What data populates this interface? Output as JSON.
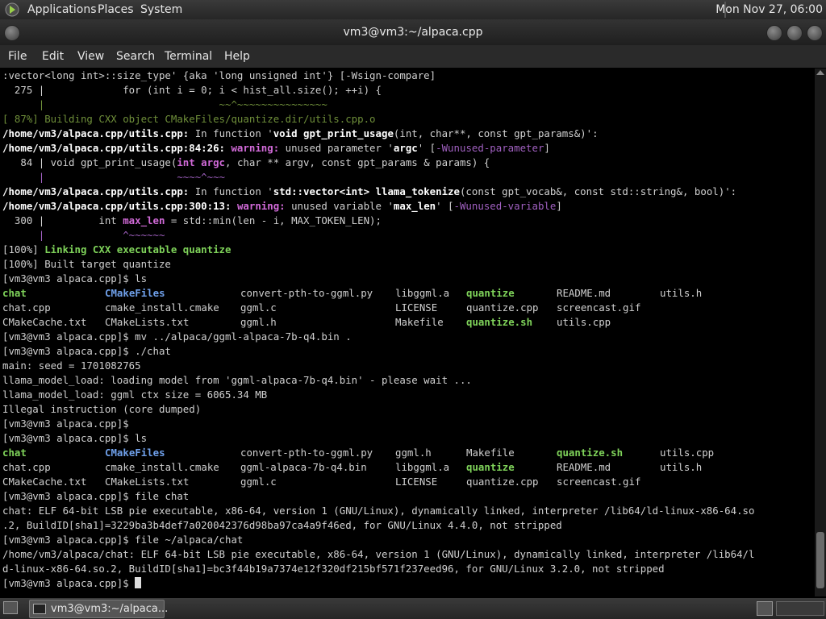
{
  "top_panel": {
    "menus": [
      "Applications",
      "Places",
      "System"
    ],
    "clock": "Mon Nov 27, 06:00"
  },
  "window": {
    "title": "vm3@vm3:~/alpaca.cpp"
  },
  "menubar": [
    "File",
    "Edit",
    "View",
    "Search",
    "Terminal",
    "Help"
  ],
  "terminal": {
    "t0": ":vector<long int>::size_type' {aka 'long unsigned int'} [-Wsign-compare]",
    "t1": "  275 |             for (int i = 0; i < hist_all.size(); ++i) {",
    "t2": "      |                             ~~^~~~~~~~~~~~~~~~",
    "t3": "[ 87%] Building CXX object CMakeFiles/quantize.dir/utils.cpp.o",
    "t4a": "/home/vm3/alpaca.cpp/utils.cpp:",
    "t4b": " In function '",
    "t4c": "void gpt_print_usage",
    "t4d": "(int, char**, const gpt_params&)':",
    "t5a": "/home/vm3/alpaca.cpp/utils.cpp:84:26:",
    "t5b": " warning:",
    "t5c": " unused parameter '",
    "t5d": "argc",
    "t5e": "' [",
    "t5f": "-Wunused-parameter",
    "t5g": "]",
    "t6a": "   84 | void gpt_print_usage(",
    "t6b": "int argc",
    "t6c": ", char ** argv, const gpt_params & params) {",
    "t7": "      |                      ~~~~^~~~",
    "t8a": "/home/vm3/alpaca.cpp/utils.cpp:",
    "t8b": " In function '",
    "t8c": "std::vector<int> llama_tokenize",
    "t8d": "(const gpt_vocab&, const std::string&, bool)':",
    "t9a": "/home/vm3/alpaca.cpp/utils.cpp:300:13:",
    "t9b": " warning:",
    "t9c": " unused variable '",
    "t9d": "max_len",
    "t9e": "' [",
    "t9f": "-Wunused-variable",
    "t9g": "]",
    "t10a": "  300 |         int ",
    "t10b": "max_len",
    "t10c": " = std::min(len - i, MAX_TOKEN_LEN);",
    "t11": "      |             ^~~~~~~",
    "t12a": "[100%] ",
    "t12b": "Linking CXX executable quantize",
    "t13": "[100%] Built target quantize",
    "t14": "[vm3@vm3 alpaca.cpp]$ ls",
    "ls1": [
      [
        "chat",
        "CMakeFiles",
        "convert-pth-to-ggml.py",
        "libggml.a",
        "quantize",
        "README.md",
        "utils.h"
      ],
      [
        "chat.cpp",
        "cmake_install.cmake",
        "ggml.c",
        "LICENSE",
        "quantize.cpp",
        "screencast.gif",
        ""
      ],
      [
        "CMakeCache.txt",
        "CMakeLists.txt",
        "ggml.h",
        "Makefile",
        "quantize.sh",
        "utils.cpp",
        ""
      ]
    ],
    "t18": "[vm3@vm3 alpaca.cpp]$ mv ../alpaca/ggml-alpaca-7b-q4.bin .",
    "t19": "[vm3@vm3 alpaca.cpp]$ ./chat",
    "t20": "main: seed = 1701082765",
    "t21": "llama_model_load: loading model from 'ggml-alpaca-7b-q4.bin' - please wait ...",
    "t22": "llama_model_load: ggml ctx size = 6065.34 MB",
    "t23": "Illegal instruction (core dumped)",
    "t24": "[vm3@vm3 alpaca.cpp]$",
    "t25": "[vm3@vm3 alpaca.cpp]$ ls",
    "ls2": [
      [
        "chat",
        "CMakeFiles",
        "convert-pth-to-ggml.py",
        "ggml.h",
        "Makefile",
        "quantize.sh",
        "utils.cpp"
      ],
      [
        "chat.cpp",
        "cmake_install.cmake",
        "ggml-alpaca-7b-q4.bin",
        "libggml.a",
        "quantize",
        "README.md",
        "utils.h"
      ],
      [
        "CMakeCache.txt",
        "CMakeLists.txt",
        "ggml.c",
        "LICENSE",
        "quantize.cpp",
        "screencast.gif",
        ""
      ]
    ],
    "t29": "[vm3@vm3 alpaca.cpp]$ file chat",
    "t30": "chat: ELF 64-bit LSB pie executable, x86-64, version 1 (GNU/Linux), dynamically linked, interpreter /lib64/ld-linux-x86-64.so",
    "t31": ".2, BuildID[sha1]=3229ba3b4def7a020042376d98ba97ca4a9f46ed, for GNU/Linux 4.4.0, not stripped",
    "t32": "[vm3@vm3 alpaca.cpp]$ file ~/alpaca/chat",
    "t33": "/home/vm3/alpaca/chat: ELF 64-bit LSB pie executable, x86-64, version 1 (GNU/Linux), dynamically linked, interpreter /lib64/l",
    "t34": "d-linux-x86-64.so.2, BuildID[sha1]=bc3f44b19a7374e12f320df215bf571f237eed96, for GNU/Linux 3.2.0, not stripped",
    "t35": "[vm3@vm3 alpaca.cpp]$ "
  },
  "taskbar": {
    "window_button": "vm3@vm3:~/alpaca..."
  }
}
